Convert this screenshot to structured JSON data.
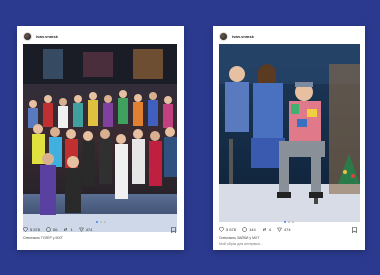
{
  "posts": [
    {
      "username": "ivan.vnmsk",
      "likes": "5 578",
      "comments": "56",
      "reposts": "1",
      "views": "474",
      "caption": "Спектакль ГУЛЕР у МХТ"
    },
    {
      "username": "ivan.vnmsk",
      "likes": "5 678",
      "comments": "144",
      "reposts": "4",
      "views": "474",
      "caption": "Спектакль ЗАЙКИ у МХТ",
      "subcaption": "Мой образ для интервью..."
    }
  ]
}
